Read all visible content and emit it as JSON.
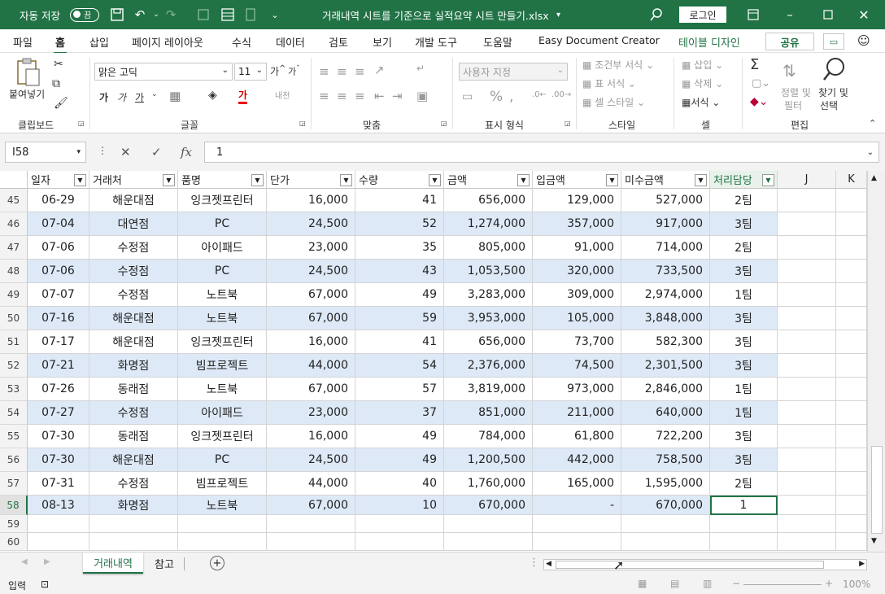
{
  "titlebar": {
    "autosave_label": "자동 저장",
    "autosave_state": "끔",
    "file_name": "거래내역 시트를 기준으로 실적요약 시트 만들기.xlsx",
    "login_label": "로그인"
  },
  "menu": {
    "items": [
      "파일",
      "홈",
      "삽입",
      "페이지 레이아웃",
      "수식",
      "데이터",
      "검토",
      "보기",
      "개발 도구",
      "도움말",
      "Easy Document Creator",
      "테이블 디자인"
    ],
    "active_index": 1,
    "share_label": "공유"
  },
  "ribbon": {
    "clipboard": {
      "paste_label": "붙여넣기",
      "group_label": "클립보드"
    },
    "font": {
      "font_name": "맑은 고딕",
      "font_size": "11",
      "group_label": "글꼴",
      "bold": "가",
      "italic": "가",
      "underline": "가",
      "grow": "가",
      "shrink": "가",
      "font_color": "가"
    },
    "alignment": {
      "group_label": "맞춤"
    },
    "number": {
      "format": "사용자 지정",
      "group_label": "표시 형식",
      "percent": "%"
    },
    "styles": {
      "conditional": "조건부 서식",
      "table": "표 서식",
      "cell": "셀 스타일",
      "group_label": "스타일"
    },
    "cells": {
      "insert": "삽입",
      "delete": "삭제",
      "format": "서식",
      "group_label": "셀"
    },
    "editing": {
      "sum": "Σ",
      "sort": "정렬 및",
      "sort2": "필터",
      "find": "찾기 및",
      "find2": "선택",
      "group_label": "편집"
    }
  },
  "formula": {
    "cell_ref": "I58",
    "value": "1",
    "fx": "fx"
  },
  "columns": [
    "일자",
    "거래처",
    "품명",
    "단가",
    "수량",
    "금액",
    "입금액",
    "미수금액",
    "처리담당",
    "J",
    "K"
  ],
  "rows": [
    {
      "num": "45",
      "date": "06-29",
      "client": "해운대점",
      "item": "잉크젯프린터",
      "price": "16,000",
      "qty": "41",
      "amount": "656,000",
      "paid": "129,000",
      "unpaid": "527,000",
      "owner": "2팀"
    },
    {
      "num": "46",
      "date": "07-04",
      "client": "대연점",
      "item": "PC",
      "price": "24,500",
      "qty": "52",
      "amount": "1,274,000",
      "paid": "357,000",
      "unpaid": "917,000",
      "owner": "3팀"
    },
    {
      "num": "47",
      "date": "07-06",
      "client": "수정점",
      "item": "아이패드",
      "price": "23,000",
      "qty": "35",
      "amount": "805,000",
      "paid": "91,000",
      "unpaid": "714,000",
      "owner": "2팀"
    },
    {
      "num": "48",
      "date": "07-06",
      "client": "수정점",
      "item": "PC",
      "price": "24,500",
      "qty": "43",
      "amount": "1,053,500",
      "paid": "320,000",
      "unpaid": "733,500",
      "owner": "3팀"
    },
    {
      "num": "49",
      "date": "07-07",
      "client": "수정점",
      "item": "노트북",
      "price": "67,000",
      "qty": "49",
      "amount": "3,283,000",
      "paid": "309,000",
      "unpaid": "2,974,000",
      "owner": "1팀"
    },
    {
      "num": "50",
      "date": "07-16",
      "client": "해운대점",
      "item": "노트북",
      "price": "67,000",
      "qty": "59",
      "amount": "3,953,000",
      "paid": "105,000",
      "unpaid": "3,848,000",
      "owner": "3팀"
    },
    {
      "num": "51",
      "date": "07-17",
      "client": "해운대점",
      "item": "잉크젯프린터",
      "price": "16,000",
      "qty": "41",
      "amount": "656,000",
      "paid": "73,700",
      "unpaid": "582,300",
      "owner": "3팀"
    },
    {
      "num": "52",
      "date": "07-21",
      "client": "화명점",
      "item": "빔프로젝트",
      "price": "44,000",
      "qty": "54",
      "amount": "2,376,000",
      "paid": "74,500",
      "unpaid": "2,301,500",
      "owner": "3팀"
    },
    {
      "num": "53",
      "date": "07-26",
      "client": "동래점",
      "item": "노트북",
      "price": "67,000",
      "qty": "57",
      "amount": "3,819,000",
      "paid": "973,000",
      "unpaid": "2,846,000",
      "owner": "1팀"
    },
    {
      "num": "54",
      "date": "07-27",
      "client": "수정점",
      "item": "아이패드",
      "price": "23,000",
      "qty": "37",
      "amount": "851,000",
      "paid": "211,000",
      "unpaid": "640,000",
      "owner": "1팀"
    },
    {
      "num": "55",
      "date": "07-30",
      "client": "동래점",
      "item": "잉크젯프린터",
      "price": "16,000",
      "qty": "49",
      "amount": "784,000",
      "paid": "61,800",
      "unpaid": "722,200",
      "owner": "3팀"
    },
    {
      "num": "56",
      "date": "07-30",
      "client": "해운대점",
      "item": "PC",
      "price": "24,500",
      "qty": "49",
      "amount": "1,200,500",
      "paid": "442,000",
      "unpaid": "758,500",
      "owner": "3팀"
    },
    {
      "num": "57",
      "date": "07-31",
      "client": "수정점",
      "item": "빔프로젝트",
      "price": "44,000",
      "qty": "40",
      "amount": "1,760,000",
      "paid": "165,000",
      "unpaid": "1,595,000",
      "owner": "2팀"
    },
    {
      "num": "58",
      "date": "08-13",
      "client": "화명점",
      "item": "노트북",
      "price": "67,000",
      "qty": "10",
      "amount": "670,000",
      "paid": "-",
      "unpaid": "670,000",
      "owner": "1"
    },
    {
      "num": "59"
    },
    {
      "num": "60"
    }
  ],
  "sheets": [
    "거래내역",
    "참고"
  ],
  "active_sheet": 0,
  "status": {
    "mode": "입력",
    "zoom": "100%"
  },
  "colors": {
    "accent": "#217346",
    "band": "#dde9f7"
  }
}
